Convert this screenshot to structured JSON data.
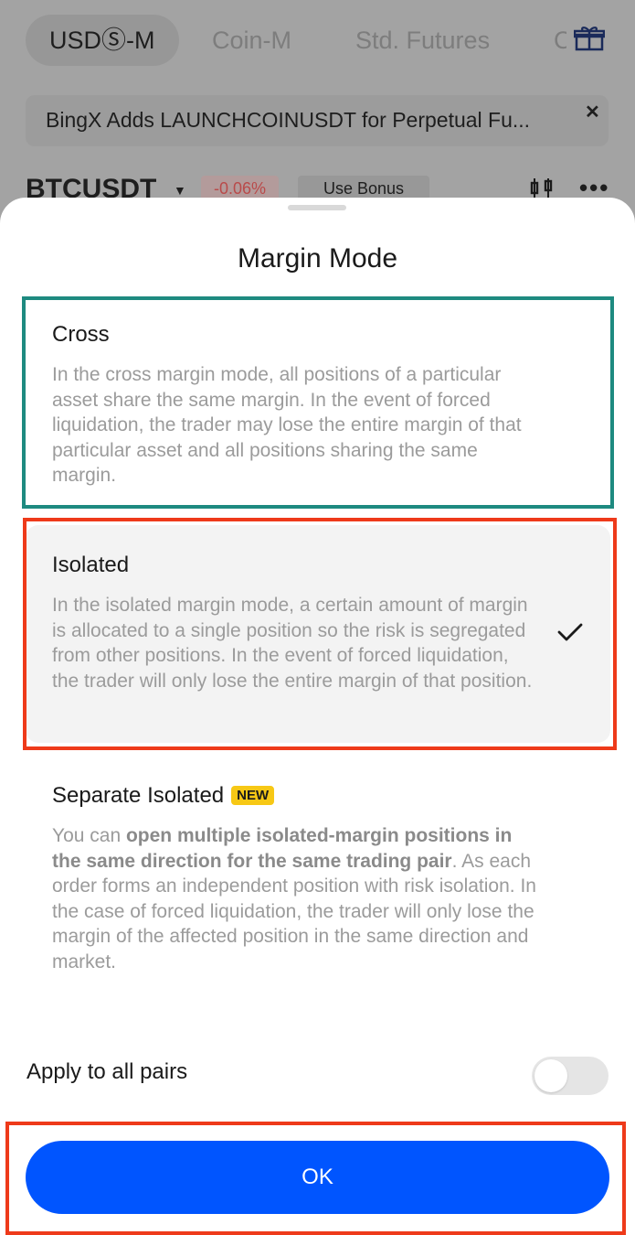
{
  "background": {
    "tabs": [
      "USDⓈ-M",
      "Coin-M",
      "Std. Futures",
      "C"
    ],
    "announcement": "BingX Adds LAUNCHCOINUSDT  for Perpetual Fu...",
    "pair": "BTCUSDT",
    "change": "-0.06%",
    "bonus_label": "Use Bonus"
  },
  "sheet": {
    "title": "Margin Mode",
    "options": [
      {
        "title": "Cross",
        "description": "In the cross margin mode, all positions of a particular asset share the same margin. In the event of forced liquidation, the trader may lose the entire margin of that particular asset and all positions sharing the same margin.",
        "selected": false
      },
      {
        "title": "Isolated",
        "description": "In the isolated margin mode, a certain amount of margin is allocated to a single position so the risk is segregated from other positions. In the event of forced liquidation, the trader will only lose the entire margin of that position.",
        "selected": true
      },
      {
        "title": "Separate Isolated",
        "badge": "NEW",
        "description_before": "You can ",
        "description_bold": "open multiple isolated-margin positions in the same direction for the same trading pair",
        "description_after": ". As each order forms an independent position with risk isolation. In the case of forced liquidation, the trader will only lose the margin of the affected position in the same direction and market.",
        "selected": false
      }
    ],
    "apply_all_label": "Apply to all pairs",
    "apply_all_enabled": false,
    "ok_label": "OK"
  },
  "colors": {
    "accent": "#0055ff",
    "highlight_teal": "#1e8a80",
    "highlight_red": "#ee3a1a",
    "badge": "#f7c815"
  }
}
